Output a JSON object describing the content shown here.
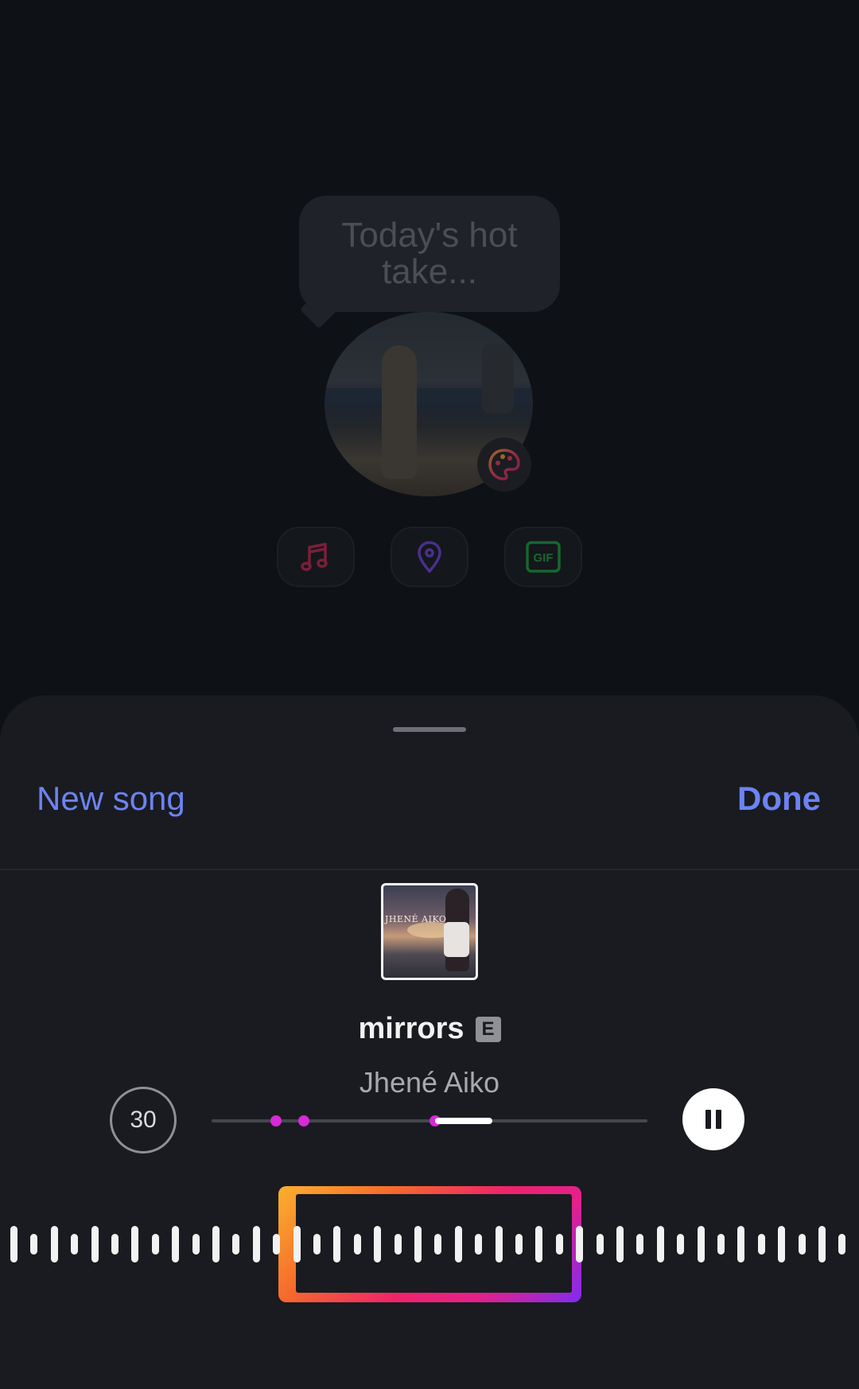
{
  "backdrop": {
    "hot_take_text": "Today's hot take...",
    "tools": [
      {
        "name": "music-icon",
        "color": "#e5265f"
      },
      {
        "name": "location-pin-icon",
        "color": "#8a4ff0"
      },
      {
        "name": "gif-icon",
        "label": "GIF",
        "color": "#22c55e"
      }
    ]
  },
  "sheet": {
    "new_song_label": "New song",
    "done_label": "Done",
    "album_art_caption": "JHENÉ AIKO",
    "song_title": "mirrors",
    "explicit_badge": "E",
    "artist": "Jhené Aiko",
    "clip_duration": "30",
    "play_state": "playing",
    "accent_color": "#6d83f2"
  }
}
